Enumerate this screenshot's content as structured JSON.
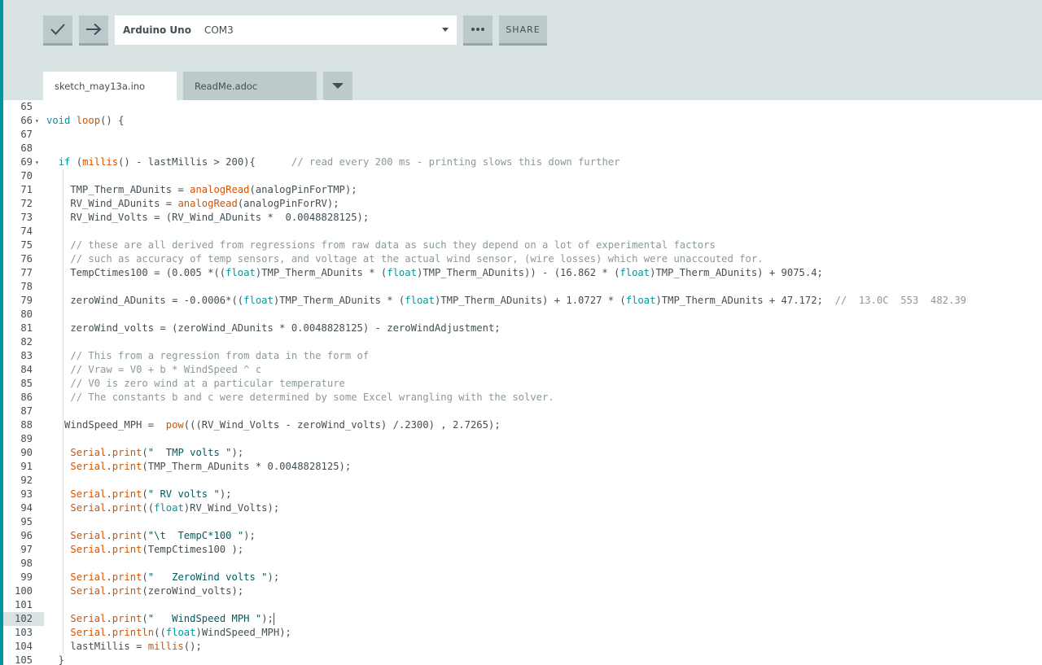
{
  "toolbar": {
    "verify_icon": "check-icon",
    "upload_icon": "arrow-right-icon",
    "board_name": "Arduino Uno",
    "port": "COM3",
    "more_icon": "ellipsis-icon",
    "share_label": "SHARE"
  },
  "tabs": [
    {
      "label": "sketch_may13a.ino",
      "active": true
    },
    {
      "label": "ReadMe.adoc",
      "active": false
    }
  ],
  "editor": {
    "current_line": 102,
    "lines": [
      {
        "n": "65",
        "text": ""
      },
      {
        "n": "66",
        "text": "void loop() {",
        "fold": true
      },
      {
        "n": "67",
        "text": ""
      },
      {
        "n": "68",
        "text": ""
      },
      {
        "n": "69",
        "text": "  if (millis() - lastMillis > 200){      // read every 200 ms - printing slows this down further",
        "fold": true
      },
      {
        "n": "70",
        "text": ""
      },
      {
        "n": "71",
        "text": "    TMP_Therm_ADunits = analogRead(analogPinForTMP);"
      },
      {
        "n": "72",
        "text": "    RV_Wind_ADunits = analogRead(analogPinForRV);"
      },
      {
        "n": "73",
        "text": "    RV_Wind_Volts = (RV_Wind_ADunits *  0.0048828125);"
      },
      {
        "n": "74",
        "text": ""
      },
      {
        "n": "75",
        "text": "    // these are all derived from regressions from raw data as such they depend on a lot of experimental factors"
      },
      {
        "n": "76",
        "text": "    // such as accuracy of temp sensors, and voltage at the actual wind sensor, (wire losses) which were unaccouted for."
      },
      {
        "n": "77",
        "text": "    TempCtimes100 = (0.005 *((float)TMP_Therm_ADunits * (float)TMP_Therm_ADunits)) - (16.862 * (float)TMP_Therm_ADunits) + 9075.4;"
      },
      {
        "n": "78",
        "text": ""
      },
      {
        "n": "79",
        "text": "    zeroWind_ADunits = -0.0006*((float)TMP_Therm_ADunits * (float)TMP_Therm_ADunits) + 1.0727 * (float)TMP_Therm_ADunits + 47.172;  //  13.0C  553  482.39"
      },
      {
        "n": "80",
        "text": ""
      },
      {
        "n": "81",
        "text": "    zeroWind_volts = (zeroWind_ADunits * 0.0048828125) - zeroWindAdjustment;"
      },
      {
        "n": "82",
        "text": ""
      },
      {
        "n": "83",
        "text": "    // This from a regression from data in the form of"
      },
      {
        "n": "84",
        "text": "    // Vraw = V0 + b * WindSpeed ^ c"
      },
      {
        "n": "85",
        "text": "    // V0 is zero wind at a particular temperature"
      },
      {
        "n": "86",
        "text": "    // The constants b and c were determined by some Excel wrangling with the solver."
      },
      {
        "n": "87",
        "text": ""
      },
      {
        "n": "88",
        "text": "   WindSpeed_MPH =  pow(((RV_Wind_Volts - zeroWind_volts) /.2300) , 2.7265);"
      },
      {
        "n": "89",
        "text": ""
      },
      {
        "n": "90",
        "text": "    Serial.print(\"  TMP volts \");"
      },
      {
        "n": "91",
        "text": "    Serial.print(TMP_Therm_ADunits * 0.0048828125);"
      },
      {
        "n": "92",
        "text": ""
      },
      {
        "n": "93",
        "text": "    Serial.print(\" RV volts \");"
      },
      {
        "n": "94",
        "text": "    Serial.print((float)RV_Wind_Volts);"
      },
      {
        "n": "95",
        "text": ""
      },
      {
        "n": "96",
        "text": "    Serial.print(\"\\t  TempC*100 \");"
      },
      {
        "n": "97",
        "text": "    Serial.print(TempCtimes100 );"
      },
      {
        "n": "98",
        "text": ""
      },
      {
        "n": "99",
        "text": "    Serial.print(\"   ZeroWind volts \");"
      },
      {
        "n": "100",
        "text": "    Serial.print(zeroWind_volts);"
      },
      {
        "n": "101",
        "text": ""
      },
      {
        "n": "102",
        "text": "    Serial.print(\"   WindSpeed MPH \");"
      },
      {
        "n": "103",
        "text": "    Serial.println((float)WindSpeed_MPH);"
      },
      {
        "n": "104",
        "text": "    lastMillis = millis();"
      },
      {
        "n": "105",
        "text": "  }"
      }
    ]
  }
}
